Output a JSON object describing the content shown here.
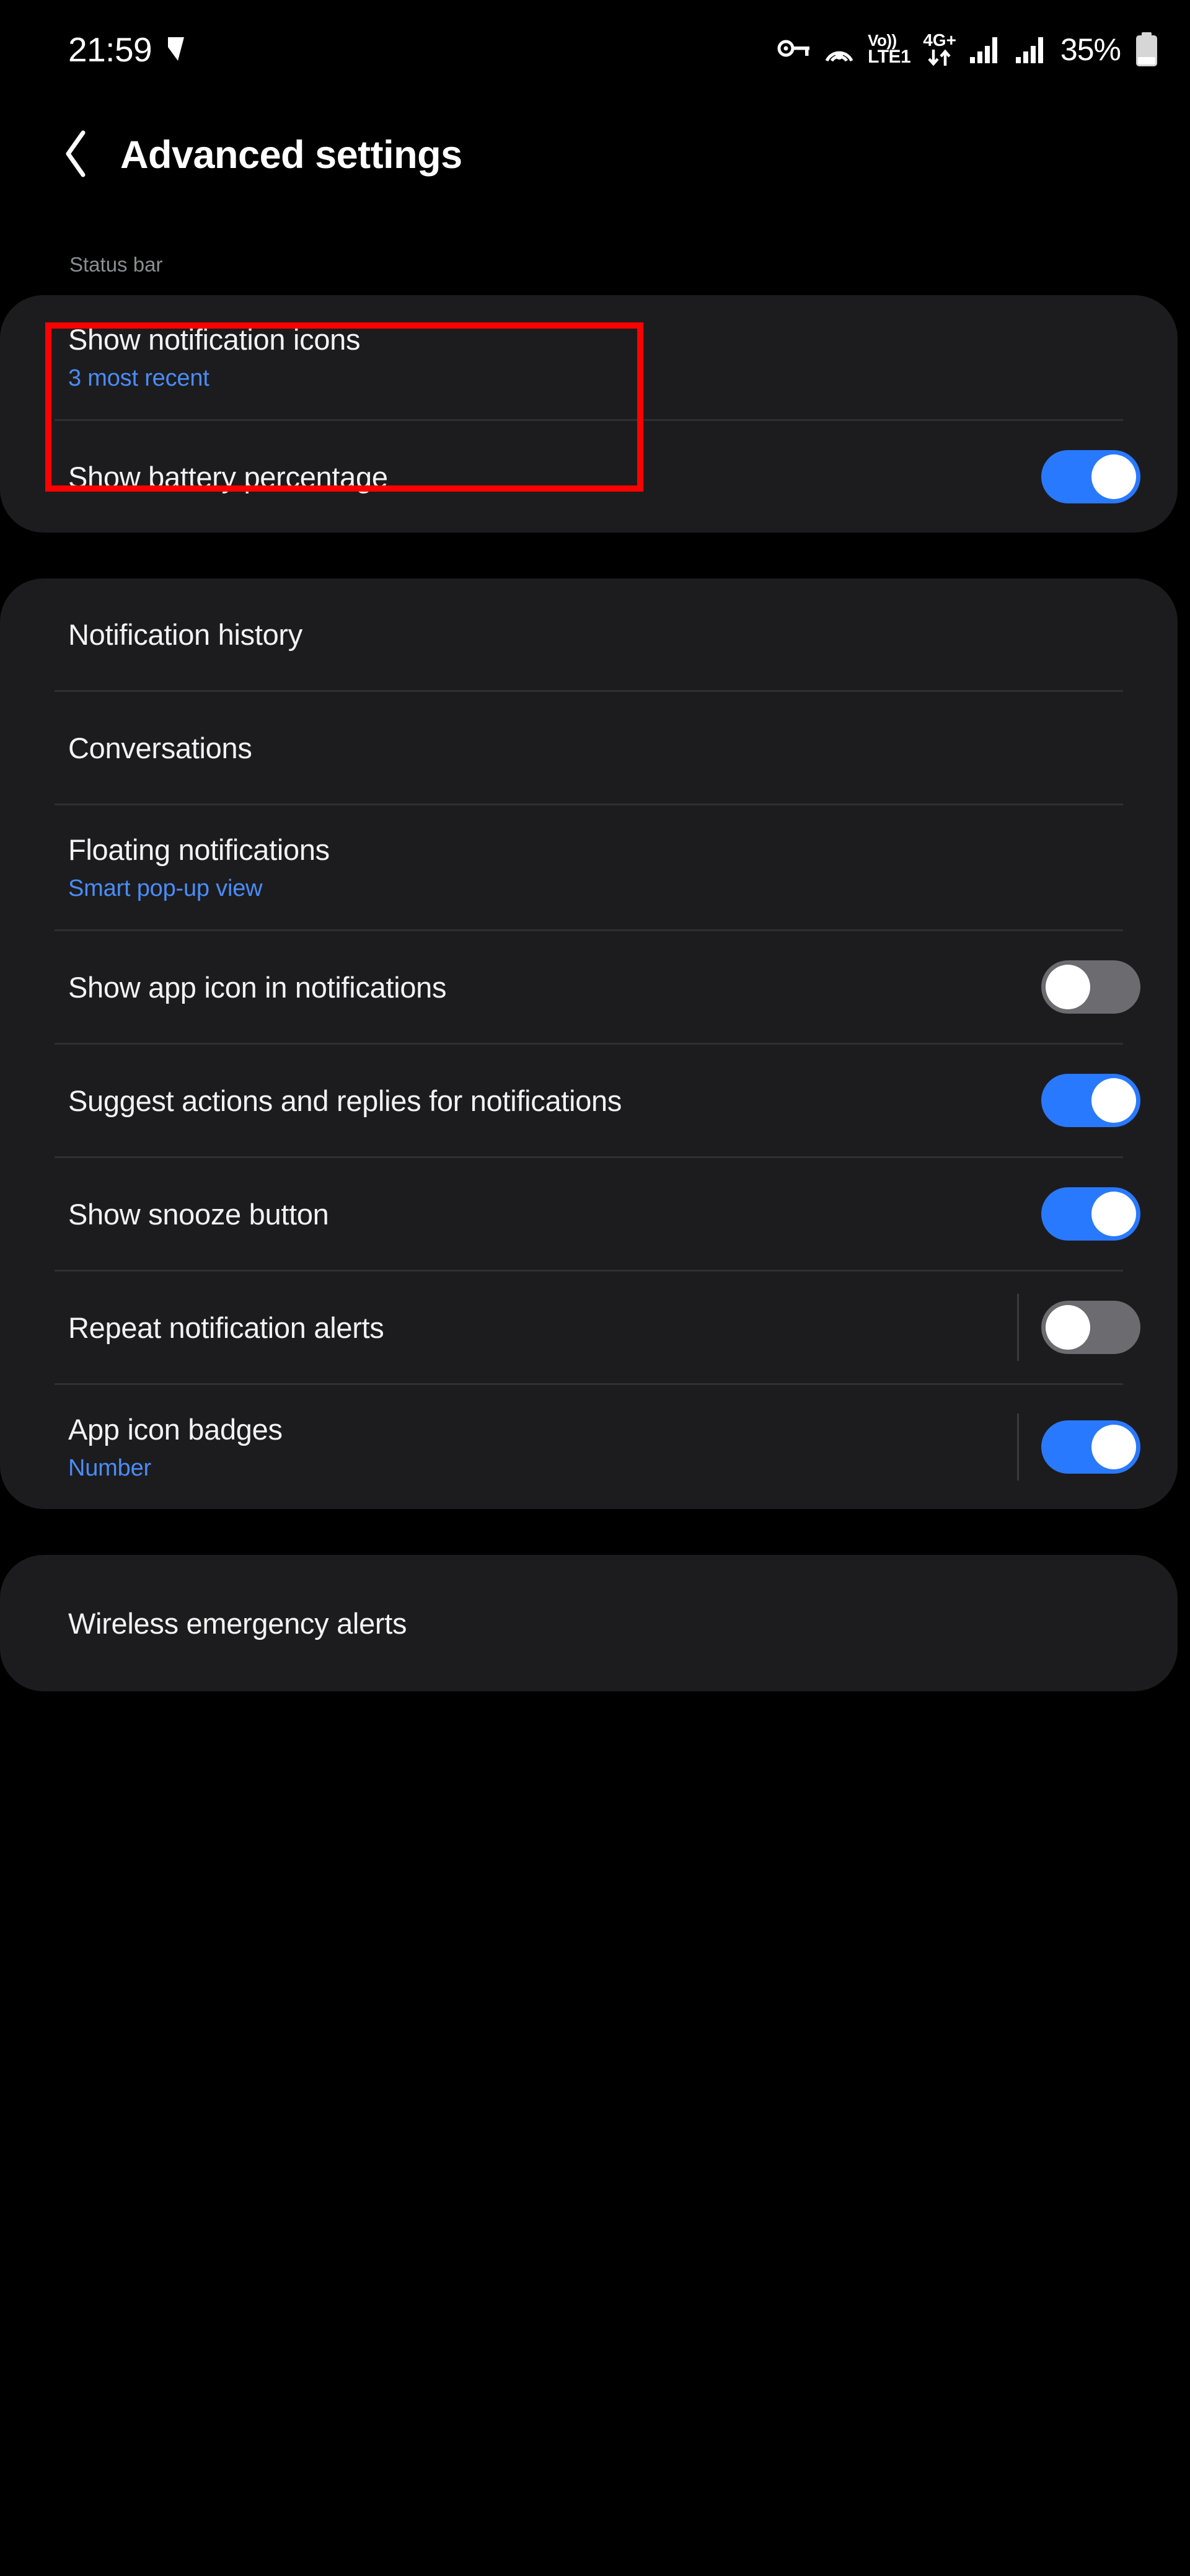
{
  "status_bar": {
    "time": "21:59",
    "check_icon": "checkmark-icon",
    "icons": [
      {
        "name": "vpn-key-icon"
      },
      {
        "name": "nfc-icon"
      }
    ],
    "volte_top": "Vo))",
    "volte_bottom": "LTE1",
    "network_type": "4G+",
    "data_arrows": "↓↑",
    "signal_1": "signal-bars-icon",
    "signal_2": "signal-bars-icon",
    "battery_percent": "35%",
    "battery_icon": "battery-icon"
  },
  "header": {
    "back_label": "back-chevron",
    "title": "Advanced settings"
  },
  "sections": [
    {
      "label": "Status bar",
      "rows": [
        {
          "title": "Show notification icons",
          "subtitle": "3 most recent",
          "control": "none",
          "highlighted": true
        },
        {
          "title": "Show battery percentage",
          "subtitle": "",
          "control": "toggle",
          "toggle_state": "on",
          "has_rule": false
        }
      ]
    },
    {
      "label": "",
      "rows": [
        {
          "title": "Notification history",
          "subtitle": "",
          "control": "none"
        },
        {
          "title": "Conversations",
          "subtitle": "",
          "control": "none"
        },
        {
          "title": "Floating notifications",
          "subtitle": "Smart pop-up view",
          "control": "none"
        },
        {
          "title": "Show app icon in notifications",
          "subtitle": "",
          "control": "toggle",
          "toggle_state": "off",
          "has_rule": false
        },
        {
          "title": "Suggest actions and replies for notifications",
          "subtitle": "",
          "control": "toggle",
          "toggle_state": "on",
          "has_rule": false
        },
        {
          "title": "Show snooze button",
          "subtitle": "",
          "control": "toggle",
          "toggle_state": "on",
          "has_rule": false
        },
        {
          "title": "Repeat notification alerts",
          "subtitle": "",
          "control": "toggle",
          "toggle_state": "off",
          "has_rule": true
        },
        {
          "title": "App icon badges",
          "subtitle": "Number",
          "control": "toggle",
          "toggle_state": "on",
          "has_rule": true
        }
      ]
    },
    {
      "label": "",
      "rows": [
        {
          "title": "Wireless emergency alerts",
          "subtitle": "",
          "control": "none"
        }
      ]
    }
  ],
  "colors": {
    "accent_blue": "#2979ff",
    "link_blue": "#4a8cf7",
    "highlight_red": "#ff0000",
    "card_bg": "#1c1c1e",
    "page_bg": "#000000"
  }
}
